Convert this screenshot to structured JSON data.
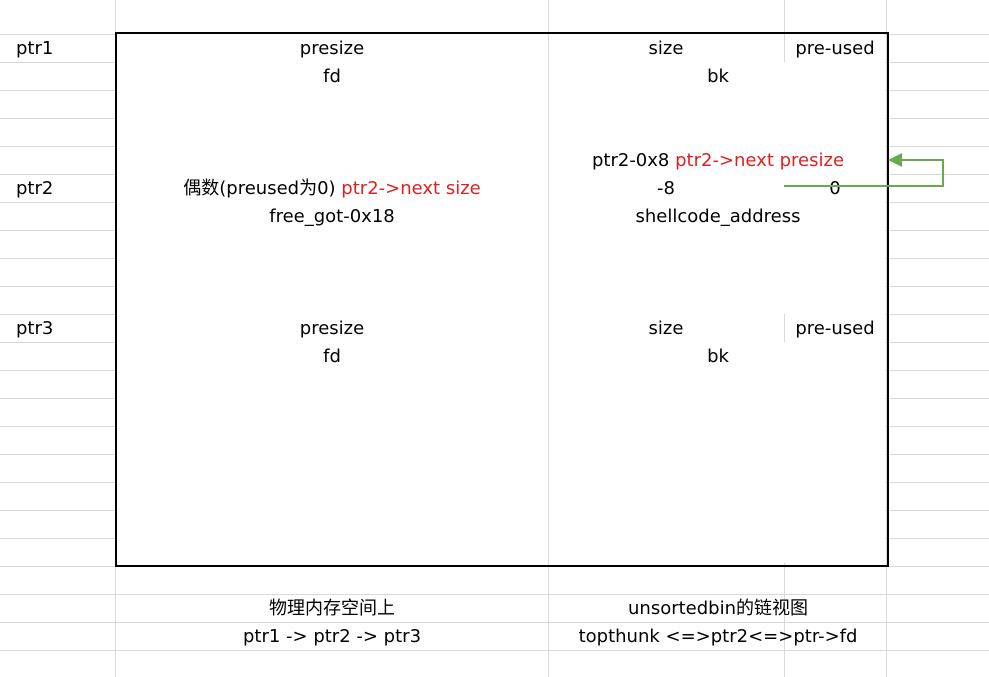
{
  "row_labels": {
    "ptr1": "ptr1",
    "ptr2": "ptr2",
    "ptr3": "ptr3"
  },
  "chunk1": {
    "presize": "presize",
    "size": "size",
    "preused": "pre-used",
    "fd": "fd",
    "bk": "bk"
  },
  "chunk2": {
    "above_black": "ptr2-0x8",
    "above_red": "ptr2->next presize",
    "presize_black": "偶数(preused为0)",
    "presize_red": "ptr2->next size",
    "size": "-8",
    "preused": "0",
    "fd": "free_got-0x18",
    "bk": "shellcode_address"
  },
  "chunk3": {
    "presize": "presize",
    "size": "size",
    "preused": "pre-used",
    "fd": "fd",
    "bk": "bk"
  },
  "caption_left": {
    "line1": "物理内存空间上",
    "line2": "ptr1 -> ptr2 -> ptr3"
  },
  "caption_right": {
    "line1": "unsortedbin的链视图",
    "line2": "topthunk <=>ptr2<=>ptr->fd"
  },
  "colors": {
    "grid": "#d9d9d9",
    "red": "#e02020",
    "arrow": "#6aa84f",
    "border": "#000000"
  }
}
